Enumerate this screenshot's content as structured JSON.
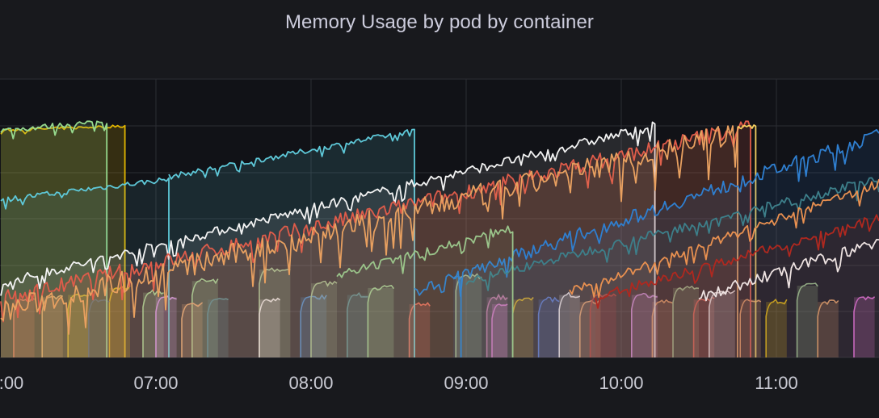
{
  "panel": {
    "title": "Memory Usage by pod by container"
  },
  "chart_data": {
    "type": "area",
    "title": "Memory Usage by pod by container",
    "xlabel": "",
    "ylabel": "",
    "grid": true,
    "legend": "none",
    "x_range": [
      "06:00",
      "11:40"
    ],
    "y_range": [
      0,
      1
    ],
    "y_tick_labels_visible": false,
    "x_ticks": [
      {
        "time": "06:00",
        "label": ":00"
      },
      {
        "time": "07:00",
        "label": "07:00"
      },
      {
        "time": "08:00",
        "label": "08:00"
      },
      {
        "time": "09:00",
        "label": "09:00"
      },
      {
        "time": "10:00",
        "label": "10:00"
      },
      {
        "time": "11:00",
        "label": "11:00"
      }
    ],
    "series": [
      {
        "color": "#e0b400",
        "start": "06:00",
        "end": "06:48",
        "from": 0.98,
        "to": 1.0,
        "noise": 0.006,
        "fill": 0.18
      },
      {
        "color": "#96d98d",
        "start": "06:00",
        "end": "06:41",
        "from": 0.98,
        "to": 1.02,
        "noise": 0.012,
        "fill": 0.14
      },
      {
        "color": "#5ec8d8",
        "start": "06:00",
        "end": "07:05",
        "from": 0.68,
        "to": 0.77,
        "noise": 0.012,
        "fill": 0.1
      },
      {
        "color": "#5ec8d8",
        "start": "07:05",
        "end": "08:40",
        "from": 0.78,
        "to": 0.98,
        "noise": 0.012,
        "fill": 0.14
      },
      {
        "color": "#f2f2f2",
        "start": "06:00",
        "end": "10:13",
        "from": 0.32,
        "to": 1.0,
        "noise": 0.02,
        "fill": 0.1
      },
      {
        "color": "#e05c4a",
        "start": "06:00",
        "end": "10:50",
        "from": 0.25,
        "to": 1.0,
        "noise": 0.035,
        "fill": 0.16
      },
      {
        "color": "#e8a060",
        "start": "06:00",
        "end": "10:45",
        "from": 0.2,
        "to": 0.97,
        "noise": 0.05,
        "fill": 0.08
      },
      {
        "color": "#f5d060",
        "start": "10:45",
        "end": "10:52",
        "from": 1.0,
        "to": 1.0,
        "noise": 0.004,
        "fill": 0.0
      },
      {
        "color": "#2f7fd0",
        "start": "08:55",
        "end": "11:40",
        "from": 0.35,
        "to": 0.96,
        "noise": 0.03,
        "fill": 0.12
      },
      {
        "color": "#2f7fd0",
        "start": "08:40",
        "end": "08:58",
        "from": 0.28,
        "to": 0.36,
        "noise": 0.02,
        "fill": 0.0
      },
      {
        "color": "#3d7f8a",
        "start": "09:00",
        "end": "11:40",
        "from": 0.33,
        "to": 0.77,
        "noise": 0.02,
        "fill": 0.06
      },
      {
        "color": "#e89050",
        "start": "09:40",
        "end": "11:40",
        "from": 0.28,
        "to": 0.75,
        "noise": 0.02,
        "fill": 0.06
      },
      {
        "color": "#f2f2f2",
        "start": "10:30",
        "end": "11:40",
        "from": 0.26,
        "to": 0.5,
        "noise": 0.025,
        "fill": 0.0
      },
      {
        "color": "#b0281f",
        "start": "09:50",
        "end": "11:40",
        "from": 0.26,
        "to": 0.6,
        "noise": 0.02,
        "fill": 0.08
      },
      {
        "color": "#9ac48a",
        "start": "08:10",
        "end": "09:18",
        "from": 0.35,
        "to": 0.56,
        "noise": 0.02,
        "fill": 0.08
      }
    ],
    "short_segments": [
      {
        "color": "#96d98d",
        "start": "06:55",
        "end": "07:03",
        "level": 0.28
      },
      {
        "color": "#e0b400",
        "start": "06:26",
        "end": "06:34",
        "level": 0.27
      },
      {
        "color": "#e0b400",
        "start": "06:42",
        "end": "06:50",
        "level": 0.3
      },
      {
        "color": "#e05c4a",
        "start": "06:05",
        "end": "06:13",
        "level": 0.25
      },
      {
        "color": "#1f3a70",
        "start": "06:34",
        "end": "06:42",
        "level": 0.25
      },
      {
        "color": "#e8a060",
        "start": "06:16",
        "end": "06:24",
        "level": 0.26
      },
      {
        "color": "#d38ef0",
        "start": "07:00",
        "end": "07:08",
        "level": 0.26
      },
      {
        "color": "#96d98d",
        "start": "07:14",
        "end": "07:24",
        "level": 0.33
      },
      {
        "color": "#e8a060",
        "start": "07:10",
        "end": "07:18",
        "level": 0.23
      },
      {
        "color": "#3d7f8a",
        "start": "07:20",
        "end": "07:28",
        "level": 0.25
      },
      {
        "color": "#9ac48a",
        "start": "07:40",
        "end": "07:52",
        "level": 0.38
      },
      {
        "color": "#f2f2f2",
        "start": "07:40",
        "end": "07:48",
        "level": 0.25
      },
      {
        "color": "#2f7fd0",
        "start": "07:56",
        "end": "08:06",
        "level": 0.26
      },
      {
        "color": "#9ac48a",
        "start": "08:00",
        "end": "08:10",
        "level": 0.32
      },
      {
        "color": "#3d7f8a",
        "start": "08:14",
        "end": "08:22",
        "level": 0.27
      },
      {
        "color": "#96d98d",
        "start": "08:22",
        "end": "08:32",
        "level": 0.3
      },
      {
        "color": "#e05c4a",
        "start": "08:38",
        "end": "08:46",
        "level": 0.23
      },
      {
        "color": "#9ac48a",
        "start": "08:56",
        "end": "09:06",
        "level": 0.35
      },
      {
        "color": "#c86aa8",
        "start": "09:08",
        "end": "09:16",
        "level": 0.26
      },
      {
        "color": "#e0b400",
        "start": "09:18",
        "end": "09:26",
        "level": 0.25
      },
      {
        "color": "#e56ad8",
        "start": "09:10",
        "end": "09:16",
        "level": 0.23
      },
      {
        "color": "#4070d8",
        "start": "09:28",
        "end": "09:36",
        "level": 0.25
      },
      {
        "color": "#f2f2f2",
        "start": "09:36",
        "end": "09:44",
        "level": 0.27
      },
      {
        "color": "#e8a060",
        "start": "09:44",
        "end": "09:52",
        "level": 0.24
      },
      {
        "color": "#b0281f",
        "start": "09:48",
        "end": "09:58",
        "level": 0.27
      },
      {
        "color": "#d38ef0",
        "start": "10:04",
        "end": "10:14",
        "level": 0.27
      },
      {
        "color": "#e8a060",
        "start": "10:12",
        "end": "10:20",
        "level": 0.24
      },
      {
        "color": "#9ac48a",
        "start": "10:20",
        "end": "10:30",
        "level": 0.3
      },
      {
        "color": "#e05c4a",
        "start": "10:28",
        "end": "10:36",
        "level": 0.25
      },
      {
        "color": "#f2f2f2",
        "start": "10:34",
        "end": "10:44",
        "level": 0.28
      },
      {
        "color": "#e8a060",
        "start": "10:46",
        "end": "10:54",
        "level": 0.25
      },
      {
        "color": "#e0b400",
        "start": "10:56",
        "end": "11:04",
        "level": 0.24
      },
      {
        "color": "#9ac48a",
        "start": "11:08",
        "end": "11:16",
        "level": 0.31
      },
      {
        "color": "#e8a060",
        "start": "11:16",
        "end": "11:24",
        "level": 0.24
      },
      {
        "color": "#e56ad8",
        "start": "11:30",
        "end": "11:38",
        "level": 0.26
      }
    ]
  }
}
